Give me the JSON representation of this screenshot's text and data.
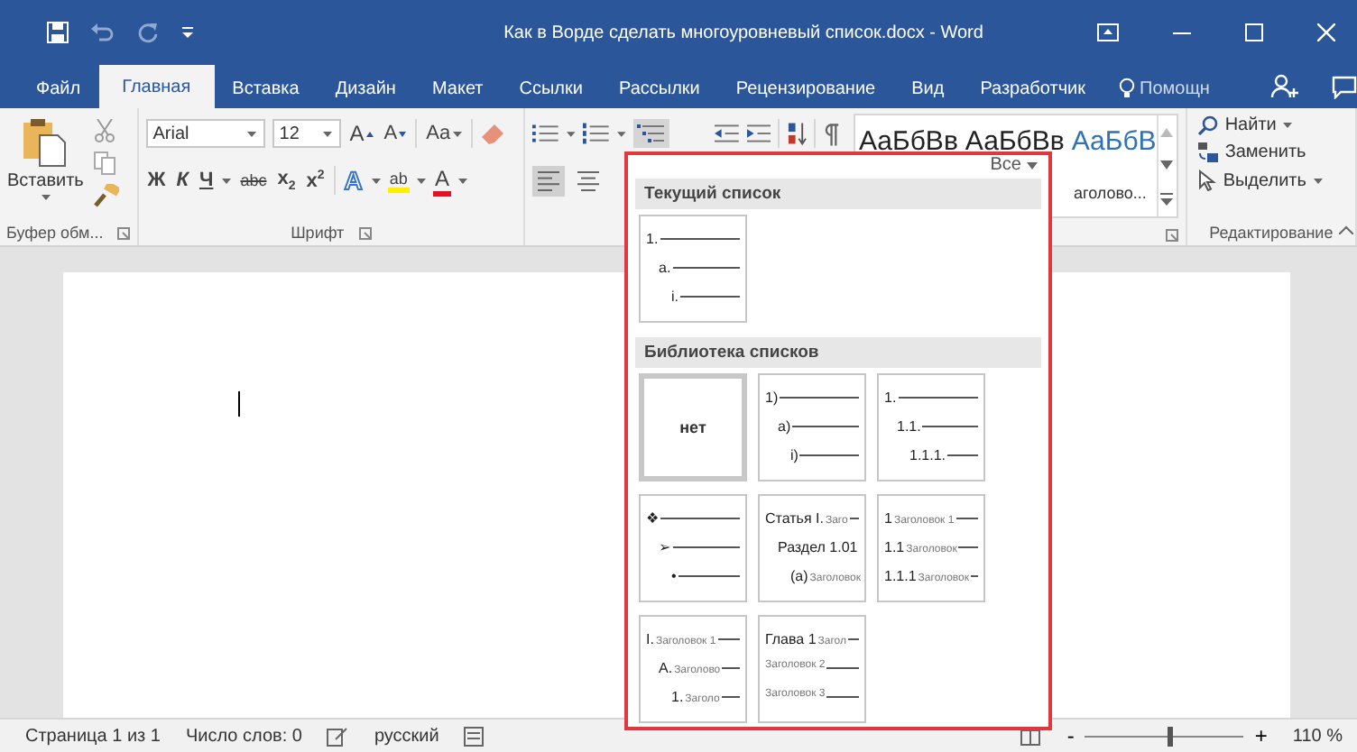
{
  "window": {
    "title": "Как в Ворде сделать многоуровневый список.docx - Word"
  },
  "tabs": [
    {
      "label": "Файл",
      "selected": false
    },
    {
      "label": "Главная",
      "selected": true
    },
    {
      "label": "Вставка",
      "selected": false
    },
    {
      "label": "Дизайн",
      "selected": false
    },
    {
      "label": "Макет",
      "selected": false
    },
    {
      "label": "Ссылки",
      "selected": false
    },
    {
      "label": "Рассылки",
      "selected": false
    },
    {
      "label": "Рецензирование",
      "selected": false
    },
    {
      "label": "Вид",
      "selected": false
    },
    {
      "label": "Разработчик",
      "selected": false
    }
  ],
  "tell_me": {
    "placeholder": "Помощн"
  },
  "ribbon": {
    "clipboard": {
      "paste": "Вставить",
      "group_label": "Буфер обм..."
    },
    "font": {
      "font_name": "Arial",
      "font_size": "12",
      "grow": "A",
      "shrink": "A",
      "case": "Aa",
      "bold": "Ж",
      "italic": "К",
      "underline": "Ч",
      "strike": "abc",
      "subscript": "x$_{2}$",
      "superscript": "x$^{2}$",
      "effects": "A",
      "highlight": "ab",
      "font_color": "A",
      "group_label": "Шрифт"
    },
    "styles": {
      "samples": [
        "АаБбВв",
        "АаБбВв",
        "АаБбВ"
      ],
      "caption": "аголово..."
    },
    "editing": {
      "find": "Найти",
      "replace": "Заменить",
      "select": "Выделить",
      "group_label": "Редактирование"
    }
  },
  "list_menu": {
    "filter": "Все",
    "current_heading": "Текущий список",
    "current": [
      {
        "kind": "stepped",
        "lines": [
          {
            "marker": "1."
          },
          {
            "marker": "a."
          },
          {
            "marker": "i."
          }
        ]
      }
    ],
    "library_heading": "Библиотека списков",
    "library": [
      {
        "kind": "none",
        "label": "нет",
        "selected": true
      },
      {
        "kind": "stepped",
        "selected": false,
        "lines": [
          {
            "marker": "1)"
          },
          {
            "marker": "a)"
          },
          {
            "marker": "i)"
          }
        ]
      },
      {
        "kind": "stepped",
        "selected": false,
        "lines": [
          {
            "marker": "1."
          },
          {
            "marker": "1.1."
          },
          {
            "marker": "1.1.1."
          }
        ]
      },
      {
        "kind": "stepped",
        "selected": false,
        "lines": [
          {
            "marker": "❖"
          },
          {
            "marker": "➢"
          },
          {
            "marker": "•"
          }
        ]
      },
      {
        "kind": "stepped",
        "selected": false,
        "lines": [
          {
            "marker": "Статья I.",
            "text": "Заго"
          },
          {
            "marker": "Раздел 1.01"
          },
          {
            "marker": "(a)",
            "text": "Заголовок"
          }
        ]
      },
      {
        "kind": "flat",
        "selected": false,
        "lines": [
          {
            "marker": "1",
            "text": "Заголовок 1"
          },
          {
            "marker": "1.1",
            "text": "Заголовок"
          },
          {
            "marker": "1.1.1",
            "text": "Заголовок"
          }
        ]
      },
      {
        "kind": "stepped",
        "selected": false,
        "lines": [
          {
            "marker": "I.",
            "text": "Заголовок 1"
          },
          {
            "marker": "A.",
            "text": "Заголово"
          },
          {
            "marker": "1.",
            "text": "Заголо"
          }
        ]
      },
      {
        "kind": "flat",
        "selected": false,
        "lines": [
          {
            "marker": "Глава 1",
            "text": "Загол"
          },
          {
            "text": "Заголовок 2"
          },
          {
            "text": "Заголовок 3"
          }
        ]
      }
    ]
  },
  "status_bar": {
    "page": "Страница 1 из 1",
    "words": "Число слов: 0",
    "language": "русский",
    "zoom": {
      "level": 0.53
    },
    "minus": "-",
    "plus": "+",
    "zoom_text": "110 %"
  }
}
